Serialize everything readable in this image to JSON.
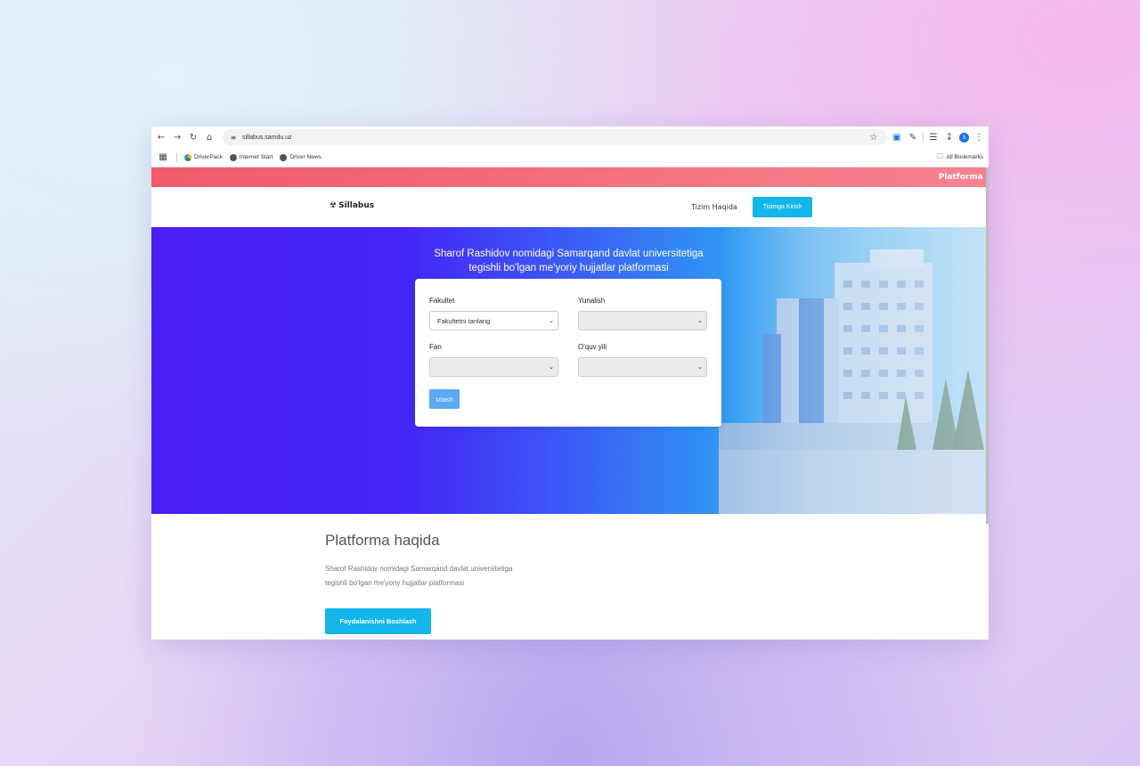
{
  "browser": {
    "url": "sillabus.samdu.uz",
    "profile_initial": "S",
    "bookmarks": [
      {
        "label": "DriverPack"
      },
      {
        "label": "Internet Start"
      },
      {
        "label": "Driver News"
      }
    ],
    "all_bookmarks": "All Bookmarks"
  },
  "marquee": {
    "text": "Platforma test"
  },
  "navbar": {
    "logo": "Sillabus",
    "about_link": "Tizim Haqida",
    "login_button": "Tizimga Kirish"
  },
  "hero": {
    "title_line1": "Sharof Rashidov nomidagi Samarqand davlat universitetiga",
    "title_line2": "tegishli bo'lgan me'yoriy hujjatlar platformasi"
  },
  "search_form": {
    "faculty_label": "Fakultet",
    "faculty_placeholder": "Fakultetni tanlang",
    "direction_label": "Yunalish",
    "direction_value": "",
    "subject_label": "Fan",
    "subject_value": "",
    "year_label": "O'quv yili",
    "year_value": "",
    "search_button": "Izlash"
  },
  "about": {
    "title": "Platforma haqida",
    "text_line1": "Sharof Rashidov nomidagi Samarqand davlat universitetiga",
    "text_line2": "tegishli bo'lgan me'yoriy hujjatlar platformasi",
    "start_button": "Foydalanishni Boshlash"
  },
  "colors": {
    "accent": "#13b5ea",
    "marquee": "#f05a6b",
    "hero_start": "#4a1ff3",
    "search_button": "#5aaaf5"
  }
}
